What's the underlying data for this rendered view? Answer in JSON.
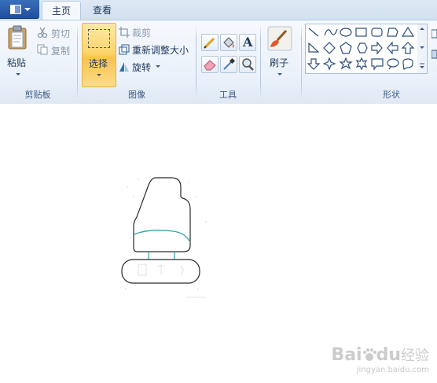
{
  "tabs": {
    "home": "主页",
    "view": "查看"
  },
  "clipboard": {
    "paste": "粘贴",
    "cut": "剪切",
    "copy": "复制",
    "group_label": "剪贴板"
  },
  "image": {
    "select": "选择",
    "crop": "裁剪",
    "resize": "重新调整大小",
    "rotate": "旋转",
    "group_label": "图像"
  },
  "tools": {
    "group_label": "工具",
    "items": [
      "pencil-icon",
      "fill-icon",
      "text-icon",
      "eraser-icon",
      "color-picker-icon",
      "magnifier-icon"
    ],
    "text_glyph": "A"
  },
  "brushes": {
    "label": "刷子"
  },
  "shapes": {
    "group_label": "形状"
  },
  "colors": {
    "accent_selected": "#fbd66e",
    "tab_active": "#f5f8fc",
    "ribbon_bg": "#eaf1fa",
    "label_text": "#1e395b"
  },
  "canvas": {
    "drawing": "sketch of a seat shape"
  },
  "watermark": {
    "brand": "Bai",
    "brand_mid": "du",
    "brand_end": "经验",
    "url": "jingyan.baidu.com"
  }
}
